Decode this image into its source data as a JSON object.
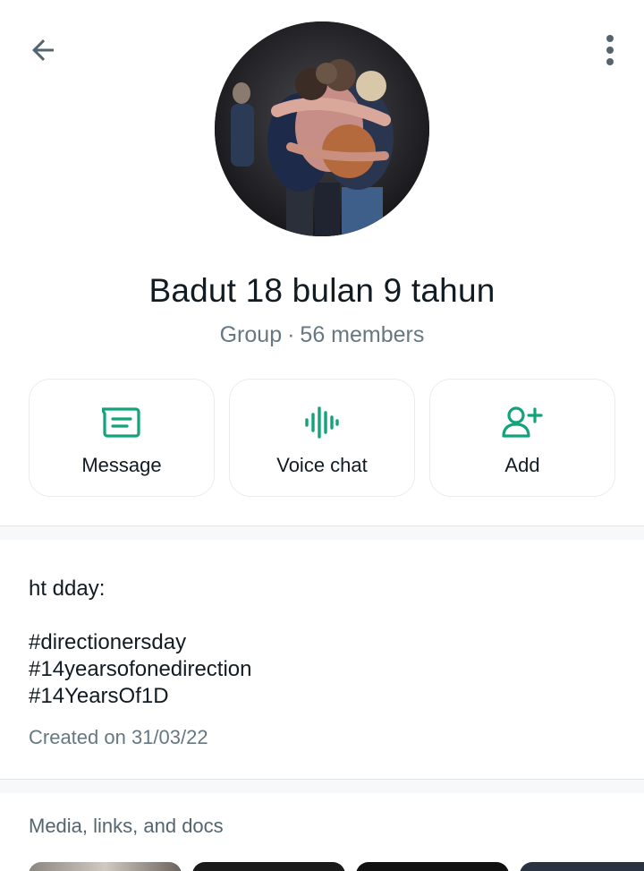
{
  "header": {
    "back_icon": "arrow-back-icon",
    "more_icon": "more-vertical-icon"
  },
  "group": {
    "name": "Badut 18 bulan 9 tahun",
    "type": "Group",
    "separator": "·",
    "members": "56 members"
  },
  "actions": [
    {
      "label": "Message",
      "icon": "message-icon"
    },
    {
      "label": "Voice chat",
      "icon": "voice-chat-icon"
    },
    {
      "label": "Add",
      "icon": "add-person-icon"
    }
  ],
  "description": {
    "text": "ht dday:\n\n#directionersday\n#14yearsofonedirection\n#14YearsOf1D",
    "created": "Created on 31/03/22"
  },
  "media": {
    "title": "Media, links, and docs"
  },
  "colors": {
    "accent": "#13a37c",
    "secondary_text": "#667781",
    "primary_text": "#111b21",
    "border": "#e9edef"
  }
}
